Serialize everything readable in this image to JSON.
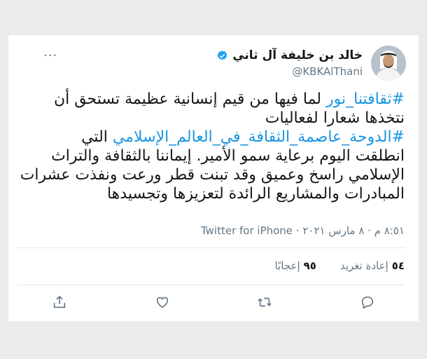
{
  "tweet": {
    "display_name": "خالد بن خليفة آل ثاني",
    "handle": "@KBKAlThani",
    "more_label": "···",
    "lines": [
      [
        {
          "t": "#ثقافتنا_نور",
          "tag": true
        },
        {
          "t": " لما فيها من قيم إنسانية عظيمة تستحق أن",
          "tag": false
        }
      ],
      [
        {
          "t": "نتخذها شعارا لفعاليات",
          "tag": false
        }
      ],
      [
        {
          "t": "#الدوحة_عاصمة_الثقافة_في_العالم_الإسلامي",
          "tag": true
        },
        {
          "t": " التي",
          "tag": false
        }
      ],
      [
        {
          "t": "انطلقت اليوم برعاية سمو الأمير. إيماننا بالثقافة والتراث",
          "tag": false
        }
      ],
      [
        {
          "t": "الإسلامي راسخ وعميق وقد تبنت قطر ورعت ونفذت عشرات",
          "tag": false
        }
      ],
      [
        {
          "t": "المبادرات والمشاريع الرائدة لتعزيزها وتجسيدها",
          "tag": false
        }
      ]
    ],
    "time": "٨:٥١ م",
    "date": "٨ مارس ٢٠٢١",
    "source": "Twitter for iPhone",
    "retweets_count": "٥٤",
    "retweets_label": "إعادة تغريد",
    "likes_count": "٩٥",
    "likes_label": "إعجابًا"
  },
  "colors": {
    "link": "#1b95e0",
    "text": "#14171a",
    "muted": "#657786",
    "verified": "#1da1f2"
  },
  "icons": [
    "verified-badge-icon",
    "more-icon",
    "reply-icon",
    "retweet-icon",
    "like-icon",
    "share-icon"
  ]
}
